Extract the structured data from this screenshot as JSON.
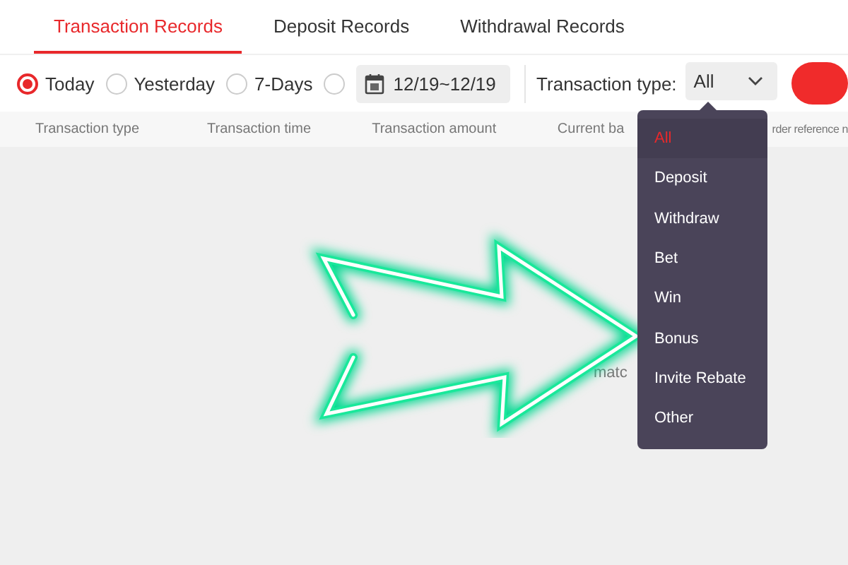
{
  "tabs": [
    {
      "label": "Transaction Records",
      "selected": true
    },
    {
      "label": "Deposit Records",
      "selected": false
    },
    {
      "label": "Withdrawal Records",
      "selected": false
    }
  ],
  "filters": {
    "ranges": [
      {
        "label": "Today",
        "selected": true
      },
      {
        "label": "Yesterday",
        "selected": false
      },
      {
        "label": "7-Days",
        "selected": false
      },
      {
        "selected": false
      }
    ],
    "date_range": "12/19~12/19",
    "type_label": "Transaction type:",
    "type_value": "All"
  },
  "table": {
    "columns": [
      "Transaction type",
      "Transaction time",
      "Transaction amount",
      "Current ba",
      "rder reference n"
    ],
    "empty_text": "matc"
  },
  "dropdown": {
    "items": [
      {
        "label": "All",
        "selected": true
      },
      {
        "label": "Deposit",
        "selected": false
      },
      {
        "label": "Withdraw",
        "selected": false
      },
      {
        "label": "Bet",
        "selected": false
      },
      {
        "label": "Win",
        "selected": false
      },
      {
        "label": "Bonus",
        "selected": false
      },
      {
        "label": "Invite Rebate",
        "selected": false
      },
      {
        "label": "Other",
        "selected": false
      }
    ]
  }
}
